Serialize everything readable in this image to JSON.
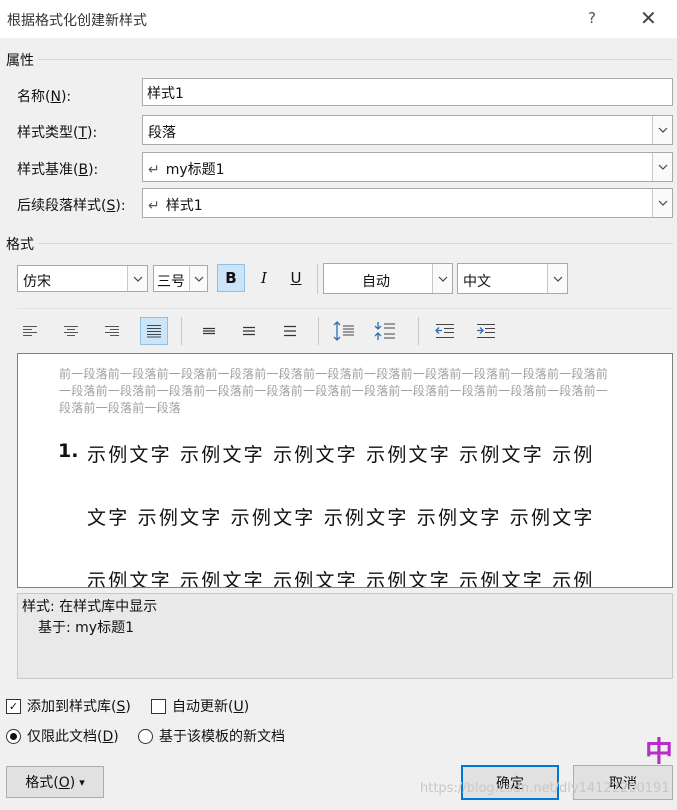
{
  "window": {
    "title": "根据格式化创建新样式",
    "help": "?",
    "close": "✕"
  },
  "properties": {
    "heading": "属性",
    "name_label": "名称(",
    "name_key": "N",
    "name_suffix": "):",
    "name_value": "样式1",
    "type_label": "样式类型(",
    "type_key": "T",
    "type_suffix": "):",
    "type_value": "段落",
    "base_label": "样式基准(",
    "base_key": "B",
    "base_suffix": "):",
    "base_value": "my标题1",
    "next_label": "后续段落样式(",
    "next_key": "S",
    "next_suffix": "):",
    "next_value": "样式1",
    "return_glyph": "↵"
  },
  "format": {
    "heading": "格式",
    "font": "仿宋",
    "size": "三号",
    "bold": "B",
    "italic": "I",
    "underline": "U",
    "color": "自动",
    "script": "中文"
  },
  "preview": {
    "prev_paragraph": "前一段落前一段落前一段落前一段落前一段落前一段落前一段落前一段落前一段落前一段落前一段落前一段落前一段落前一段落前一段落前一段落前一段落前一段落前一段落前一段落前一段落前一段落前一段落前一段落前一段落",
    "number": "1.",
    "line1": "示例文字 示例文字 示例文字 示例文字 示例文字 示例",
    "line2": "文字 示例文字 示例文字 示例文字 示例文字 示例文字",
    "line3": "示例文字 示例文字 示例文字 示例文字 示例文字 示例"
  },
  "description": {
    "line1": "样式: 在样式库中显示",
    "line2": "基于: my标题1"
  },
  "options": {
    "add_to_gallery_prefix": "添加到样式库(",
    "add_to_gallery_key": "S",
    "add_to_gallery_suffix": ")",
    "add_to_gallery_checked": true,
    "auto_update_prefix": "自动更新(",
    "auto_update_key": "U",
    "auto_update_suffix": ")",
    "auto_update_checked": false,
    "only_doc_prefix": "仅限此文档(",
    "only_doc_key": "D",
    "only_doc_suffix": ")",
    "template_docs": "基于该模板的新文档",
    "check_glyph": "✓"
  },
  "buttons": {
    "format_prefix": "格式(",
    "format_key": "O",
    "format_suffix": ")",
    "format_arrow": "▾",
    "ok": "确定",
    "cancel": "取消"
  },
  "overlay": {
    "watermark": "https://blog.csdn.net/dly14122200191",
    "logo": "中"
  }
}
